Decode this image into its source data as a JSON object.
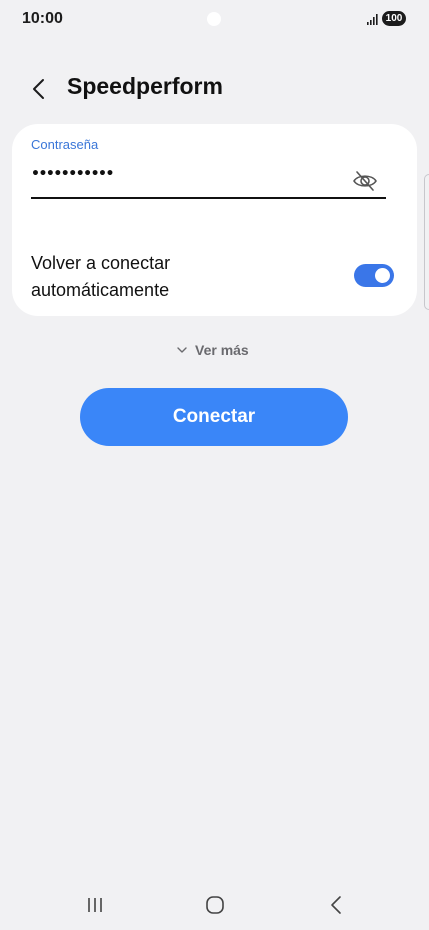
{
  "status_bar": {
    "time": "10:00",
    "battery": "100",
    "icons": [
      "signal-icon",
      "battery-icon"
    ]
  },
  "app_bar": {
    "title": "Speedperform",
    "back_icon": "chevron-left-icon"
  },
  "form": {
    "password_label": "Contraseña",
    "password_value": "•••••••••••",
    "visibility_icon": "eye-off-icon",
    "auto_reconnect_label": "Volver a conectar automáticamente",
    "auto_reconnect_enabled": true
  },
  "more": {
    "label": "Ver más",
    "icon": "chevron-down-icon"
  },
  "actions": {
    "connect_label": "Conectar"
  },
  "nav_bar": {
    "icons": [
      "recent-apps-icon",
      "home-icon",
      "back-icon"
    ]
  },
  "colors": {
    "accent": "#3a86f8",
    "label_accent": "#3a76d8",
    "background": "#f1f1f3",
    "card": "#ffffff"
  }
}
